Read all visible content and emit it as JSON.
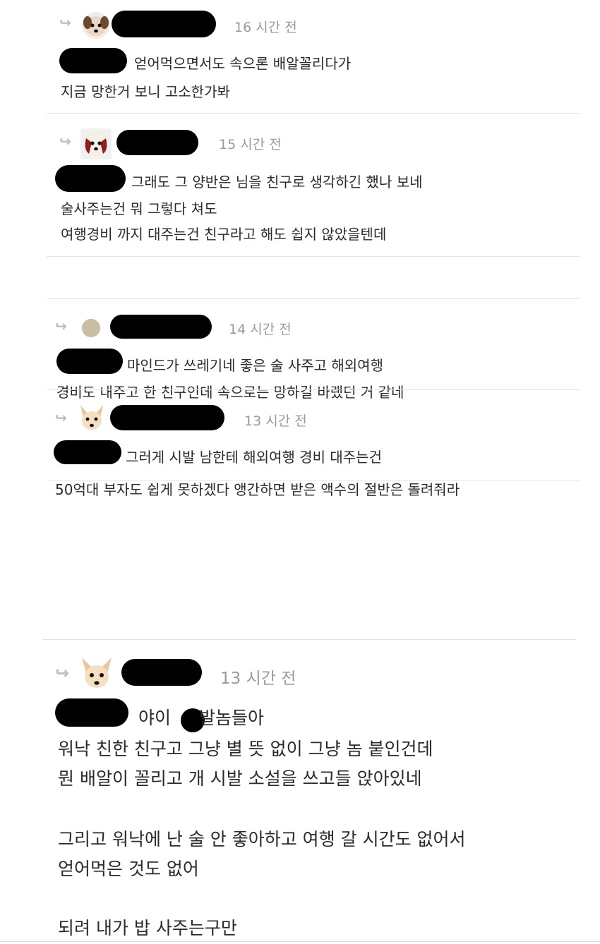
{
  "comments": [
    {
      "time": "16 시간 전",
      "avatar_icon": "dog-face-icon",
      "lines": [
        "얻어먹으면서도 속으론 배알꼴리다가",
        "지금 망한거 보니 고소한가봐"
      ]
    },
    {
      "time": "15 시간 전",
      "avatar_icon": "dog-face-icon",
      "lines": [
        "그래도 그 양반은 님을 친구로 생각하긴 했나 보네",
        "술사주는건 뭐 그렇다 쳐도",
        "여행경비 까지 대주는건 친구라고 해도 쉽지 않았을텐데"
      ]
    },
    {
      "time": "14 시간 전",
      "avatar_icon": "default-avatar-icon",
      "lines": [
        "마인드가 쓰레기네 좋은 술 사주고 해외여행",
        "경비도 내주고 한 친구인데 속으로는 망하길 바랬던 거 같네"
      ]
    },
    {
      "time": "13 시간 전",
      "avatar_icon": "fox-dog-icon",
      "lines": [
        "그러게 시발 남한테 해외여행 경비 대주는건",
        "50억대 부자도 쉽게 못하겠다 앵간하면 받은 액수의 절반은 돌려줘라"
      ]
    },
    {
      "time": "13 시간 전",
      "avatar_icon": "fox-dog-icon",
      "lines": [
        "야이",
        "발놈들아",
        "워낙 친한 친구고 그냥 별 뜻 없이 그냥 놈 붙인건데",
        "뭔 배알이 꼴리고 개 시발 소설을 쓰고들 앉아있네",
        "그리고 워낙에 난 술 안 좋아하고 여행 갈 시간도 없어서",
        "얻어먹은 것도 없어",
        "되려 내가 밥 사주는구만"
      ]
    }
  ],
  "reply_glyph": "↪"
}
